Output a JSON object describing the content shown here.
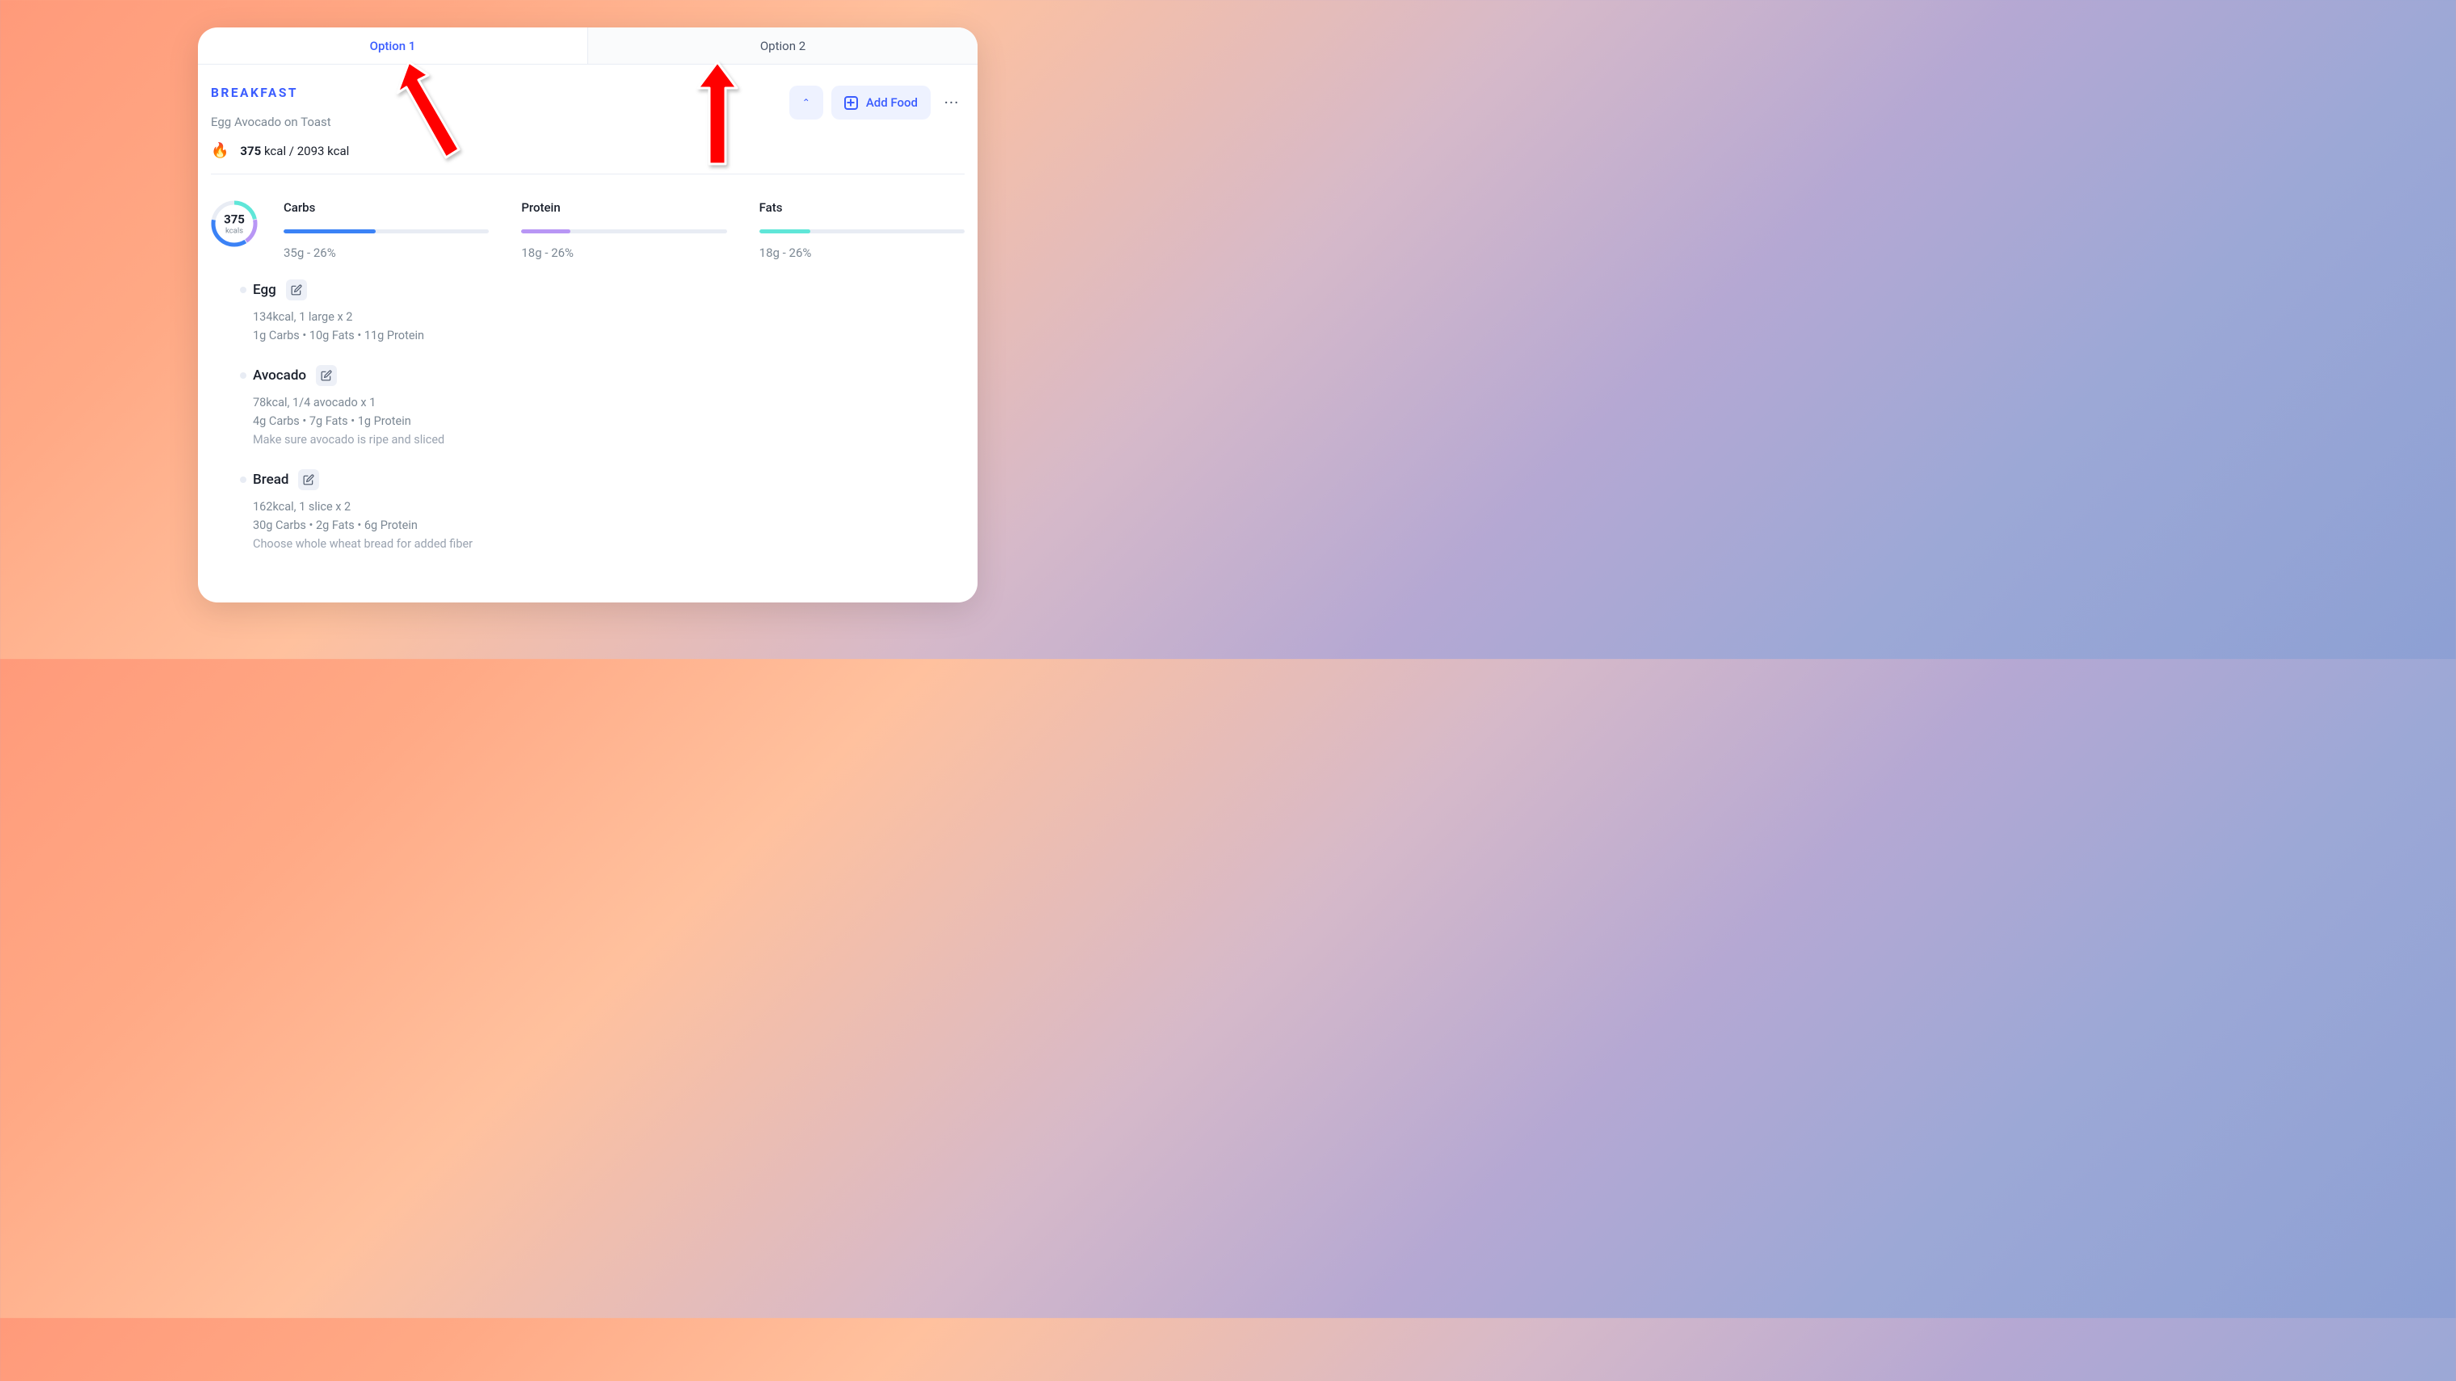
{
  "tabs": {
    "option1": "Option 1",
    "option2": "Option 2"
  },
  "meal": {
    "title": "BREAKFAST",
    "subtitle": "Egg Avocado on Toast",
    "fire": "🔥",
    "cal_value": "375",
    "cal_unit": " kcal / 2093 kcal"
  },
  "buttons": {
    "add_food": "Add Food",
    "chev": "⌃",
    "more": "···"
  },
  "ring": {
    "value": "375",
    "unit": "kcals"
  },
  "macros": [
    {
      "label": "Carbs",
      "detail": "35g - 26%",
      "pct": 45,
      "color": "#3b82f6"
    },
    {
      "label": "Protein",
      "detail": "18g - 26%",
      "pct": 24,
      "color": "#b896f5"
    },
    {
      "label": "Fats",
      "detail": "18g - 26%",
      "pct": 25,
      "color": "#5fe6d8"
    }
  ],
  "foods": [
    {
      "name": "Egg",
      "l1": "134kcal, 1 large x 2",
      "l2": "1g Carbs • 10g Fats • 11g Protein",
      "note": ""
    },
    {
      "name": "Avocado",
      "l1": "78kcal, 1/4 avocado x 1",
      "l2": "4g Carbs • 7g Fats • 1g Protein",
      "note": "Make sure avocado is ripe and sliced"
    },
    {
      "name": "Bread",
      "l1": "162kcal, 1 slice x 2",
      "l2": "30g Carbs • 2g Fats • 6g Protein",
      "note": "Choose whole wheat bread for added fiber"
    }
  ],
  "colors": {
    "accent": "#3b5dff"
  }
}
